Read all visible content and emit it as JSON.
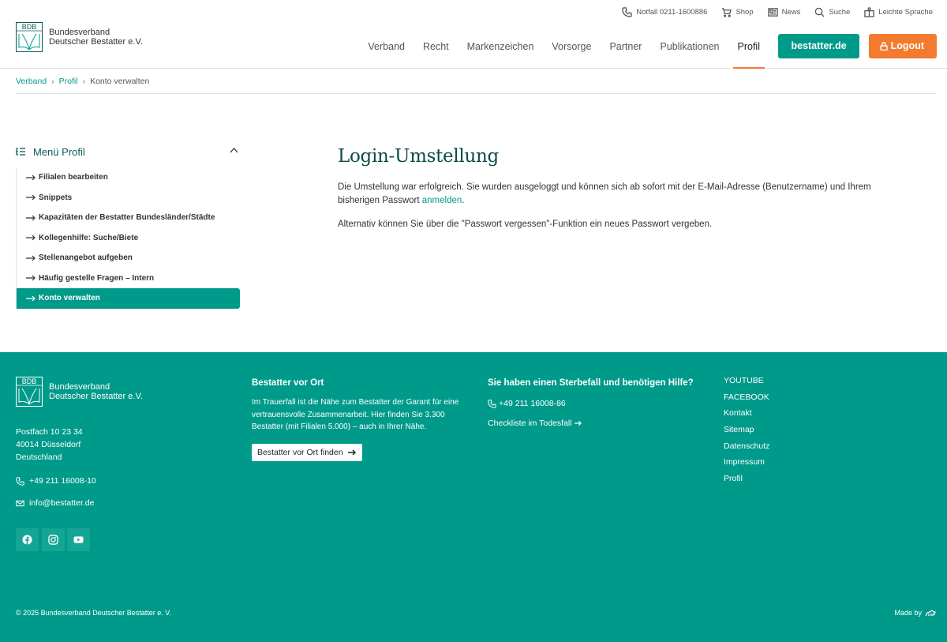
{
  "header": {
    "logo": {
      "mark": "BDB",
      "line1": "Bundesverband",
      "line2": "Deutscher Bestatter e.V."
    },
    "utility": [
      {
        "icon": "phone-icon",
        "label": "Notfall 0211-1600886"
      },
      {
        "icon": "cart-icon",
        "label": "Shop"
      },
      {
        "icon": "newspaper-icon",
        "label": "News"
      },
      {
        "icon": "search-icon",
        "label": "Suche"
      },
      {
        "icon": "easy-language-icon",
        "label": "Leichte Sprache"
      }
    ],
    "nav": [
      "Verband",
      "Recht",
      "Markenzeichen",
      "Vorsorge",
      "Partner",
      "Publikationen",
      "Profil"
    ],
    "active_nav": "Profil",
    "btn_site": "bestatter.de",
    "btn_logout": "Logout",
    "colors": {
      "teal": "#009a8a",
      "orange": "#f47a30"
    }
  },
  "breadcrumb": {
    "items": [
      "Verband",
      "Profil"
    ],
    "current": "Konto verwalten",
    "separator": "›"
  },
  "sidebar": {
    "title": "Menü Profil",
    "items": [
      "Filialen bearbeiten",
      "Snippets",
      "Kapazitäten der Bestatter Bundesländer/Städte",
      "Kollegenhilfe: Suche/Biete",
      "Stellenangebot aufgeben",
      "Häufig gestelle Fragen – Intern",
      "Konto verwalten"
    ],
    "active_index": 6
  },
  "main": {
    "title": "Login-Umstellung",
    "p1_before": "Die Umstellung war erfolgreich. Sie wurden ausgeloggt und können sich ab sofort mit der E-Mail-Adresse (Benutzername) und Ihrem bisherigen Passwort ",
    "p1_link": "anmelden",
    "p1_after": ".",
    "p2": "Alternativ können Sie über die \"Passwort vergessen\"-Funktion ein neues Passwort vergeben."
  },
  "footer": {
    "logo": {
      "mark": "BDB",
      "line1": "Bundesverband",
      "line2": "Deutscher Bestatter e.V."
    },
    "address": [
      "Postfach 10 23 34",
      "40014 Düsseldorf",
      "Deutschland"
    ],
    "phone": "+49 211 16008-10",
    "email": "info@bestatter.de",
    "socials": [
      "facebook-icon",
      "instagram-icon",
      "youtube-icon"
    ],
    "col2": {
      "heading": "Bestatter vor Ort",
      "text": "Im Trauerfall ist die Nähe zum Bestatter der Garant für eine vertrauensvolle Zusammenarbeit. Hier finden Sie 3.300 Bestatter (mit Filialen 5.000) – auch in Ihrer Nähe.",
      "button": "Bestatter vor Ort finden"
    },
    "col3": {
      "heading": "Sie haben einen Sterbefall und benötigen Hilfe?",
      "phone": "+49 211 16008-86",
      "checklist": "Checkliste im Todesfall"
    },
    "links": [
      "YOUTUBE",
      "FACEBOOK",
      "Kontakt",
      "Sitemap",
      "Datenschutz",
      "Impressum",
      "Profil"
    ],
    "copyright": "© 2025 Bundesverband Deutscher Bestatter e. V.",
    "madeby": "Made by"
  }
}
